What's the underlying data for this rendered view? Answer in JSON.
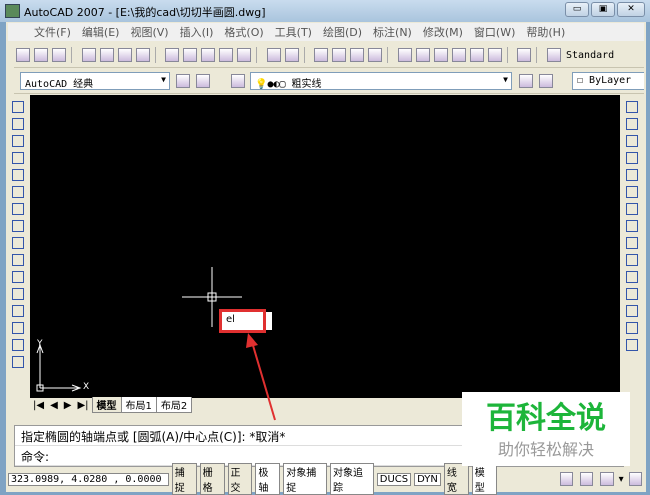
{
  "window": {
    "title": "AutoCAD 2007 - [E:\\我的cad\\切切半画圆.dwg]",
    "minimize": "▭",
    "maximize": "▣",
    "close": "✕"
  },
  "menu": [
    "文件(F)",
    "编辑(E)",
    "视图(V)",
    "插入(I)",
    "格式(O)",
    "工具(T)",
    "绘图(D)",
    "标注(N)",
    "修改(M)",
    "窗口(W)",
    "帮助(H)"
  ],
  "toolbar": {
    "text_style": "Standard"
  },
  "workspace": {
    "value": "AutoCAD 经典"
  },
  "layer": {
    "value": "粗实线"
  },
  "color": {
    "value": "ByLayer"
  },
  "canvas": {
    "input_value": "el",
    "ucs_x": "X",
    "ucs_y": "Y"
  },
  "tabs": [
    "模型",
    "布局1",
    "布局2"
  ],
  "tab_nav": [
    "|◀",
    "◀",
    "▶",
    "▶|"
  ],
  "command": {
    "history": "指定椭圆的轴端点或 [圆弧(A)/中心点(C)]: *取消*",
    "prompt": "命令:"
  },
  "status": {
    "coords": "323.0989, 4.0280 , 0.0000",
    "toggles": [
      {
        "label": "捕捉",
        "on": false
      },
      {
        "label": "栅格",
        "on": false
      },
      {
        "label": "正交",
        "on": false
      },
      {
        "label": "极轴",
        "on": true
      },
      {
        "label": "对象捕捉",
        "on": true
      },
      {
        "label": "对象追踪",
        "on": true
      },
      {
        "label": "DUCS",
        "on": true
      },
      {
        "label": "DYN",
        "on": true
      },
      {
        "label": "线宽",
        "on": false
      },
      {
        "label": "模型",
        "on": true
      }
    ]
  },
  "watermark": {
    "title": "百科全说",
    "subtitle": "助你轻松解决"
  },
  "colors": {
    "accent_red": "#e03030",
    "watermark_green": "#1db53a"
  }
}
